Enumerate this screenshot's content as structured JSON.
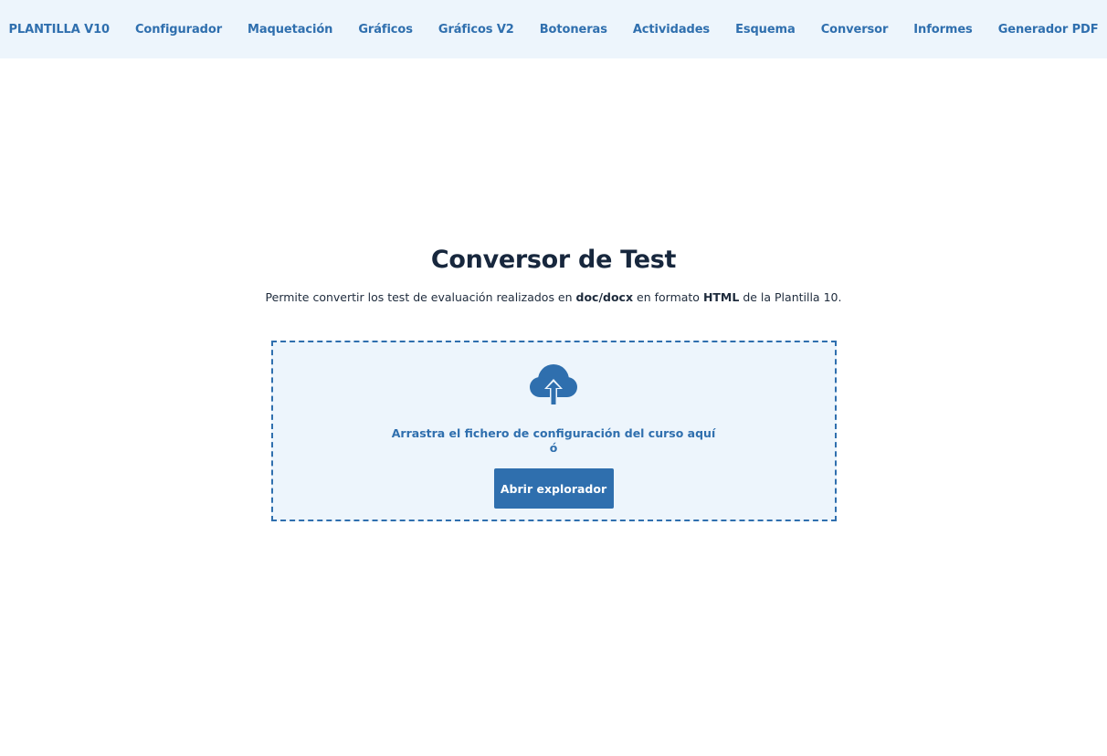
{
  "nav": {
    "items": [
      {
        "label": "PLANTILLA V10"
      },
      {
        "label": "Configurador"
      },
      {
        "label": "Maquetación"
      },
      {
        "label": "Gráficos"
      },
      {
        "label": "Gráficos V2"
      },
      {
        "label": "Botoneras"
      },
      {
        "label": "Actividades"
      },
      {
        "label": "Esquema"
      },
      {
        "label": "Conversor"
      },
      {
        "label": "Informes"
      },
      {
        "label": "Generador PDF"
      }
    ]
  },
  "main": {
    "title": "Conversor de Test",
    "description": {
      "part1": "Permite convertir los test de evaluación realizados en ",
      "format_in": "doc/docx",
      "part2": " en formato ",
      "format_out": "HTML",
      "part3": " de la Plantilla 10."
    },
    "dropzone": {
      "icon": "cloud-upload-icon",
      "text": "Arrastra el fichero de configuración del curso aquí",
      "or_text": "ó",
      "button_label": "Abrir explorador"
    }
  },
  "colors": {
    "accent": "#2f6fae",
    "nav_background": "#edf5fc",
    "title": "#17273d"
  }
}
